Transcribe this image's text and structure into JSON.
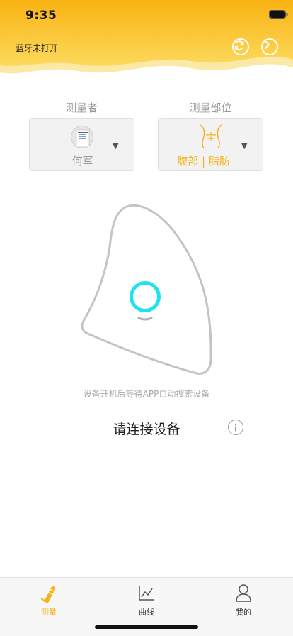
{
  "status_bar": {
    "time": "9:35"
  },
  "header": {
    "bluetooth_status": "蓝牙未打开",
    "accent_color": "#f7b21a"
  },
  "selectors": {
    "measurer": {
      "label": "测量者",
      "value": "何军"
    },
    "part": {
      "label": "测量部位",
      "value": "腹部 | 脂肪"
    }
  },
  "device": {
    "hint": "设备开机后等待APP自动搜索设备",
    "connect_text": "请连接设备",
    "ring_color": "#1ee3ee"
  },
  "tabbar": {
    "tabs": [
      {
        "label": "测量",
        "icon": "measure-icon",
        "active": true
      },
      {
        "label": "曲线",
        "icon": "chart-icon",
        "active": false
      },
      {
        "label": "我的",
        "icon": "person-icon",
        "active": false
      }
    ]
  }
}
